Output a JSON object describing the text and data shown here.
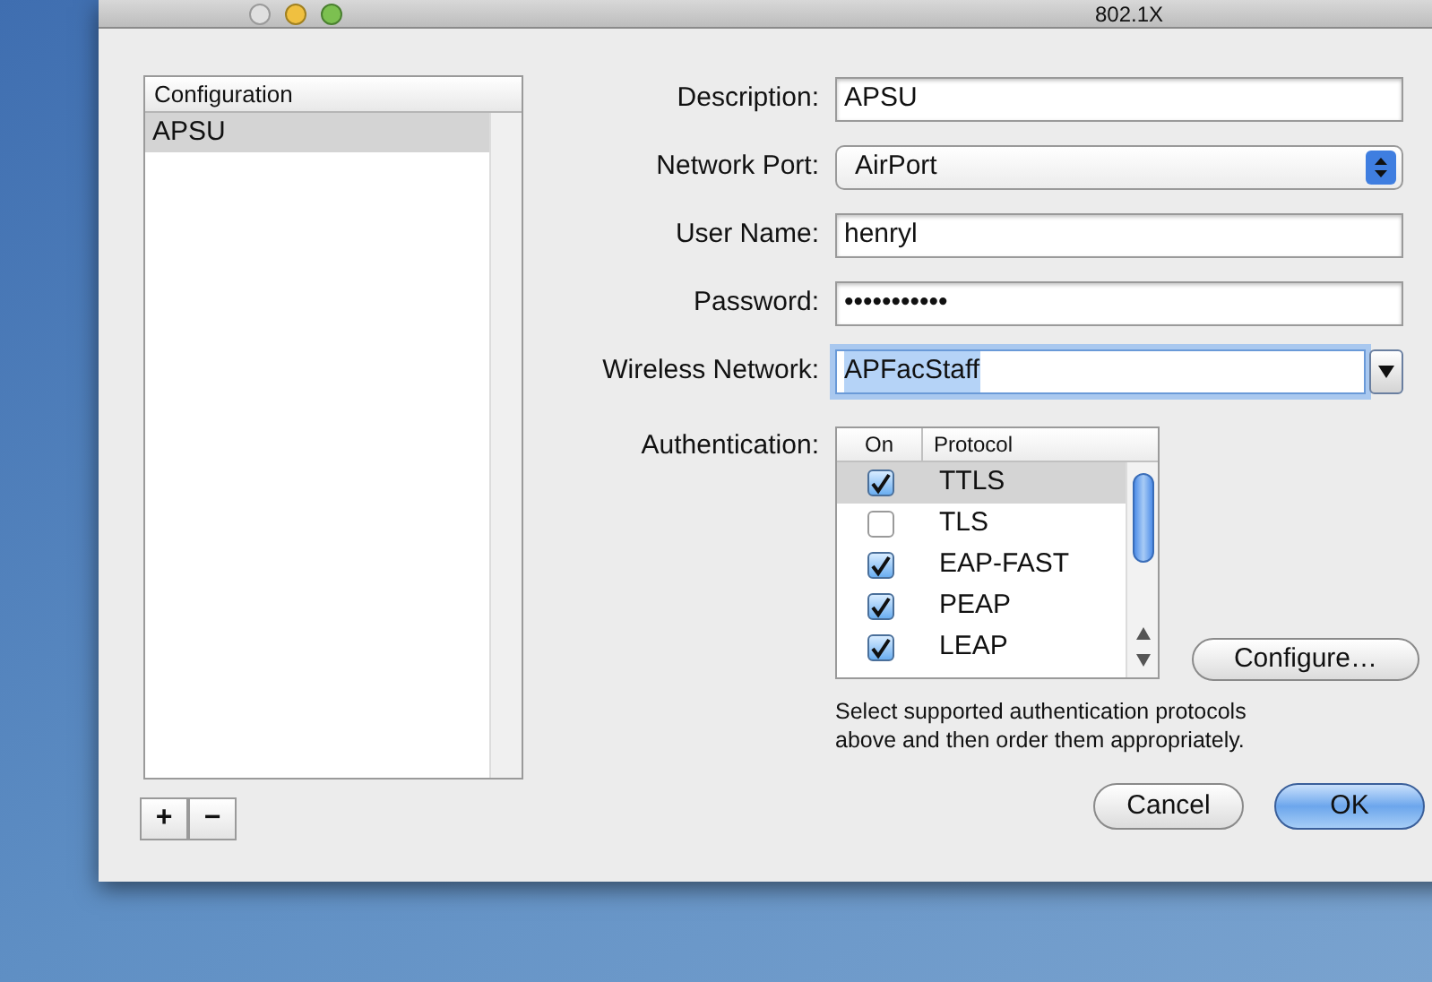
{
  "window": {
    "title": "802.1X"
  },
  "configurations": {
    "header": "Configuration",
    "items": [
      {
        "label": "APSU",
        "selected": true
      }
    ]
  },
  "list_buttons": [
    "+",
    "−"
  ],
  "form": [
    {
      "kind": "text",
      "label": "Description:",
      "value": "APSU"
    },
    {
      "kind": "popup",
      "label": "Network Port:",
      "value": "AirPort"
    },
    {
      "kind": "text",
      "label": "User Name:",
      "value": "henryl"
    },
    {
      "kind": "password",
      "label": "Password:",
      "value": "•••••••••••"
    },
    {
      "kind": "combo",
      "label": "Wireless Network:",
      "value": "APFacStaff",
      "focused": true
    }
  ],
  "authentication": {
    "label": "Authentication:",
    "columns": [
      "On",
      "Protocol"
    ],
    "protocols": [
      {
        "name": "TTLS",
        "checked": true,
        "selected": true
      },
      {
        "name": "TLS",
        "checked": false,
        "selected": false
      },
      {
        "name": "EAP-FAST",
        "checked": true,
        "selected": false
      },
      {
        "name": "PEAP",
        "checked": true,
        "selected": false
      },
      {
        "name": "LEAP",
        "checked": true,
        "selected": false
      }
    ],
    "configure_button": "Configure…",
    "hint": "Select supported authentication protocols above and then order them appropriately."
  },
  "buttons": [
    {
      "label": "Cancel",
      "default": false
    },
    {
      "label": "OK",
      "default": true
    }
  ]
}
